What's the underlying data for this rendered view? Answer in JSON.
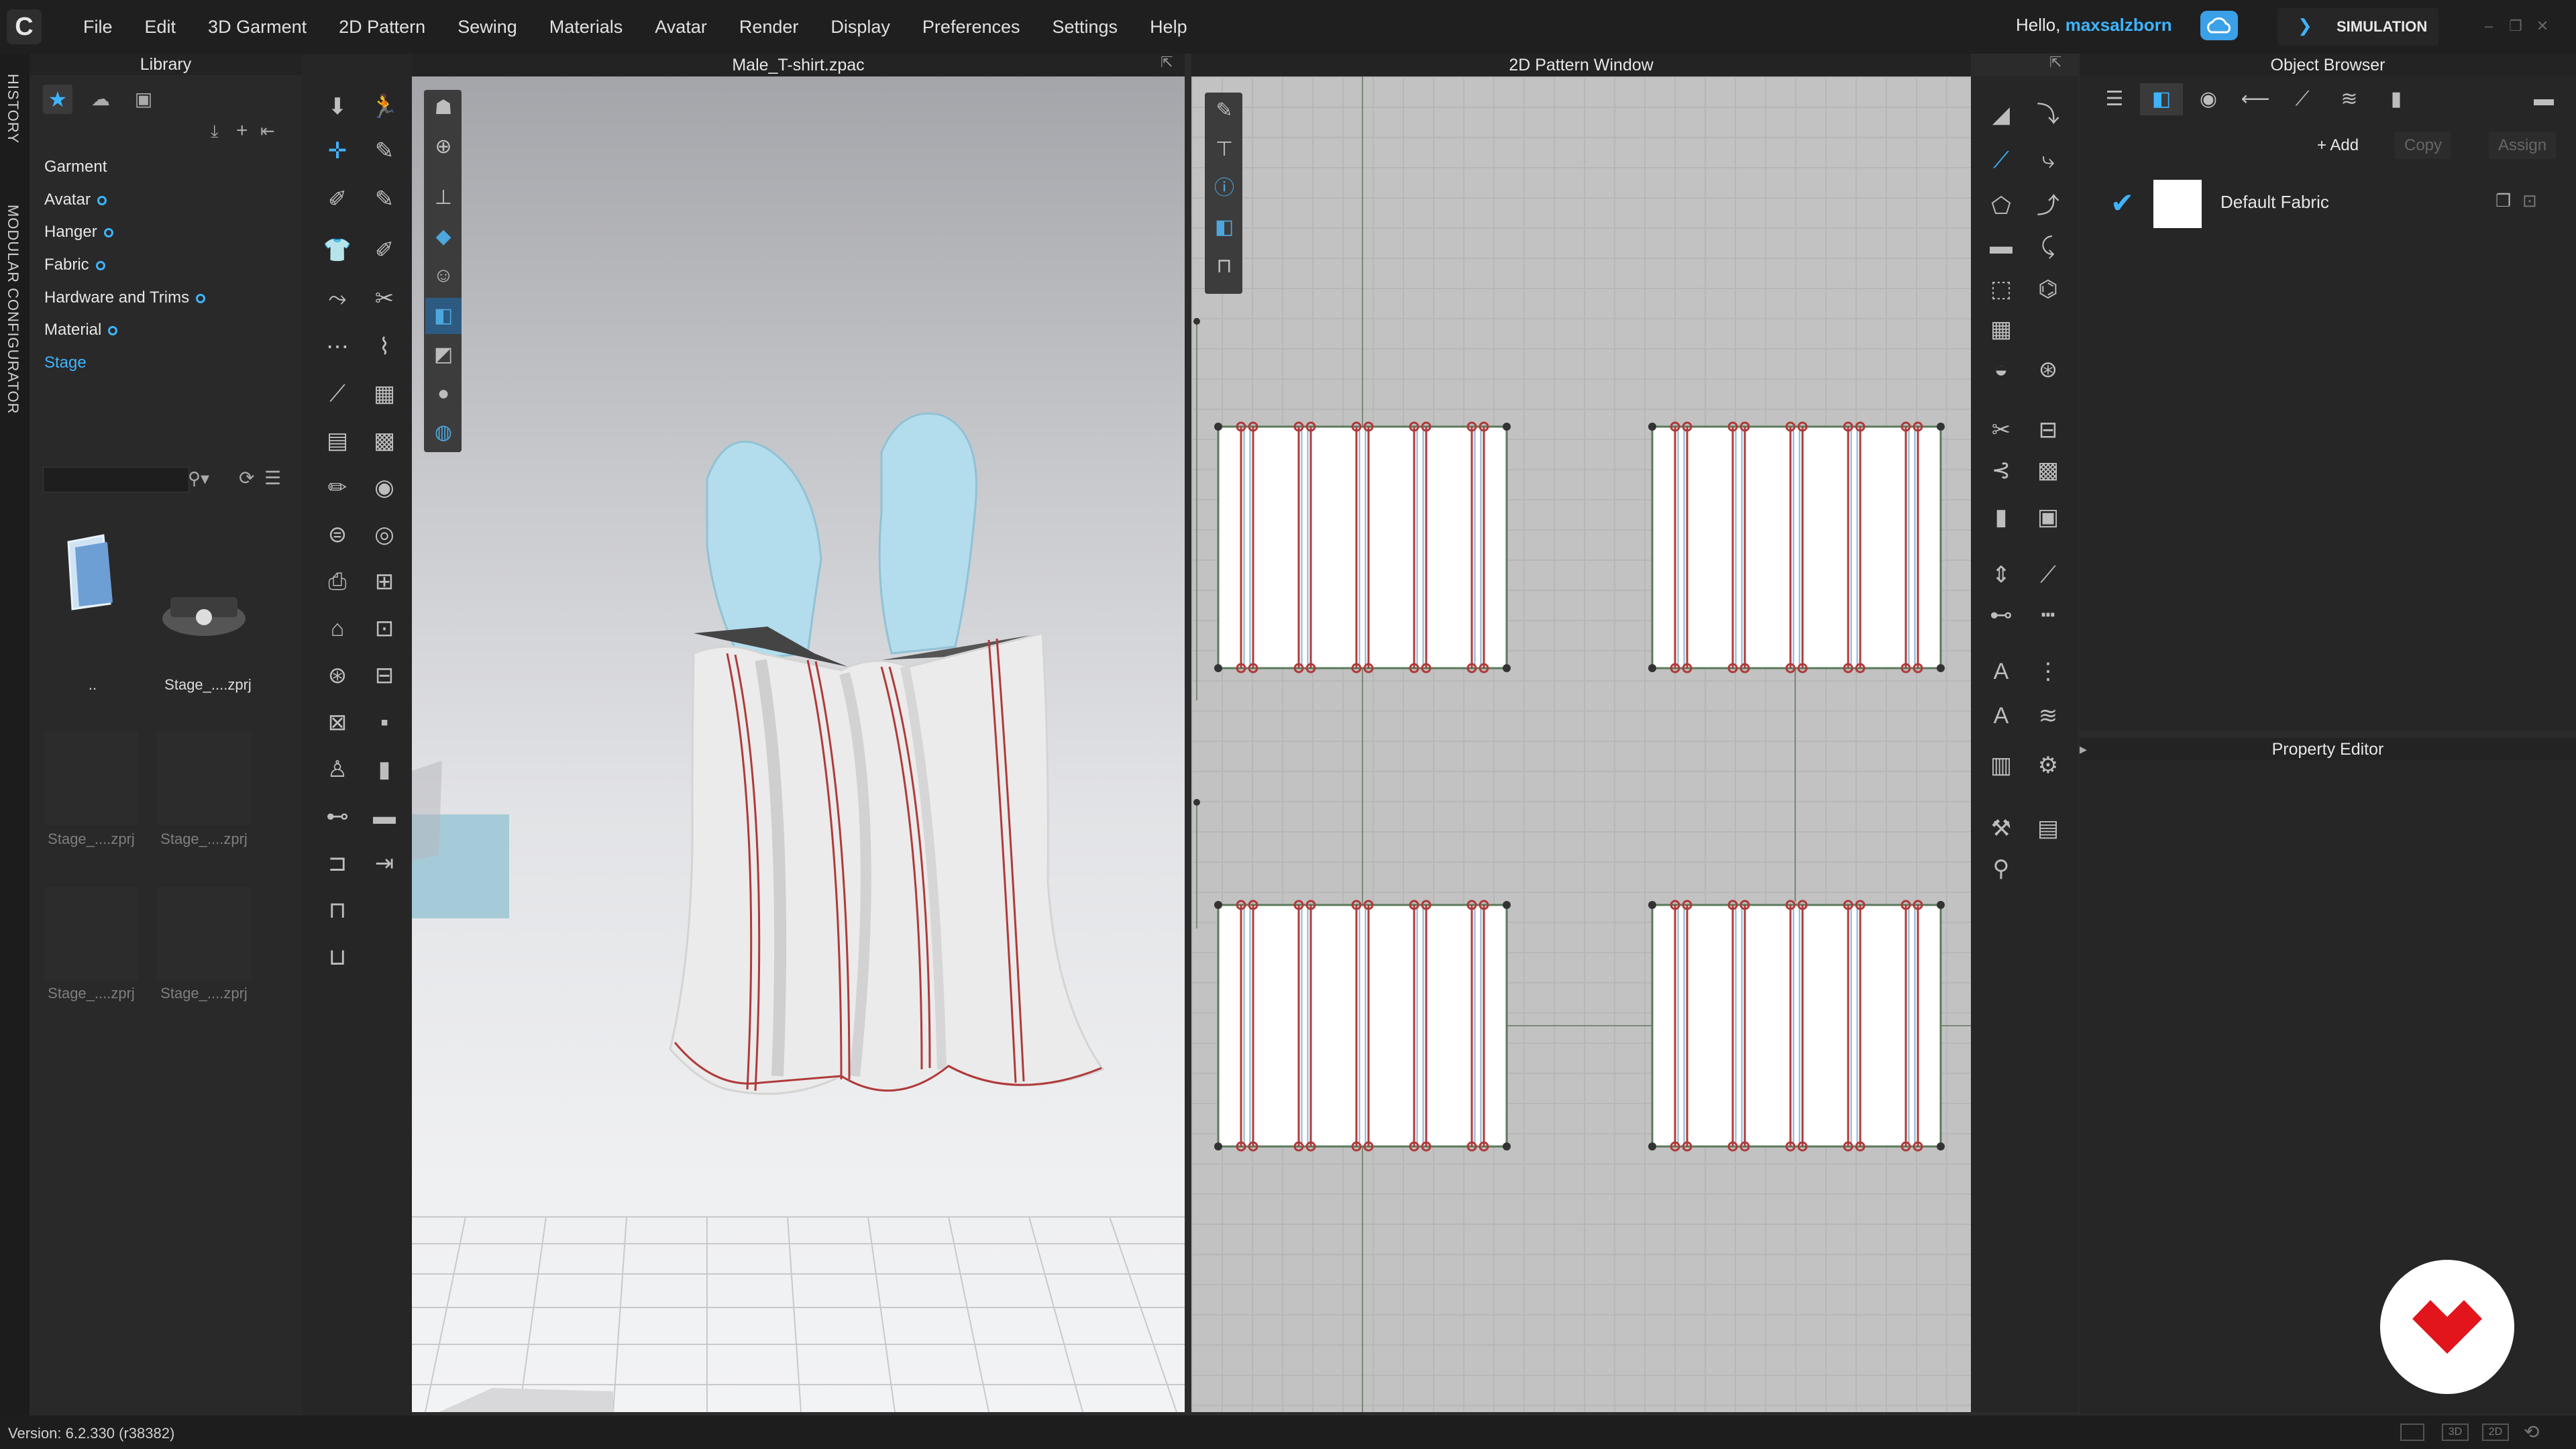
{
  "app": {
    "logo_glyph": "C",
    "menu": [
      "File",
      "Edit",
      "3D Garment",
      "2D Pattern",
      "Sewing",
      "Materials",
      "Avatar",
      "Render",
      "Display",
      "Preferences",
      "Settings",
      "Help"
    ],
    "greeting": "Hello,",
    "username": "maxsalzborn",
    "mode_button": "SIMULATION",
    "accent_color": "#3eb4ff"
  },
  "side_tabs": {
    "history": "HISTORY",
    "modular": "MODULAR CONFIGURATOR"
  },
  "library": {
    "title": "Library",
    "items": [
      "Garment",
      "Avatar",
      "Hanger",
      "Fabric",
      "Hardware and Trims",
      "Material",
      "Stage"
    ],
    "thumbnails": [
      {
        "label": ".."
      },
      {
        "label": "Stage_....zprj"
      },
      {
        "label": "Stage_....zprj"
      },
      {
        "label": "Stage_....zprj"
      },
      {
        "label": "Stage_....zprj"
      },
      {
        "label": "Stage_....zprj"
      }
    ]
  },
  "window_3d": {
    "title": "Male_T-shirt.zpac"
  },
  "window_2d": {
    "title": "2D Pattern Window"
  },
  "object_browser": {
    "title": "Object Browser",
    "buttons": {
      "add": "Add",
      "copy": "Copy",
      "assign": "Assign"
    },
    "fabric_name": "Default Fabric"
  },
  "property_editor": {
    "title": "Property Editor"
  },
  "status": {
    "version": "Version: 6.2.330 (r38382)",
    "view_buttons": [
      "3D",
      "2D"
    ]
  },
  "icons": [
    "search-icon",
    "refresh-icon",
    "list-icon",
    "star-icon",
    "cloud-icon",
    "check-icon",
    "plus-icon"
  ]
}
